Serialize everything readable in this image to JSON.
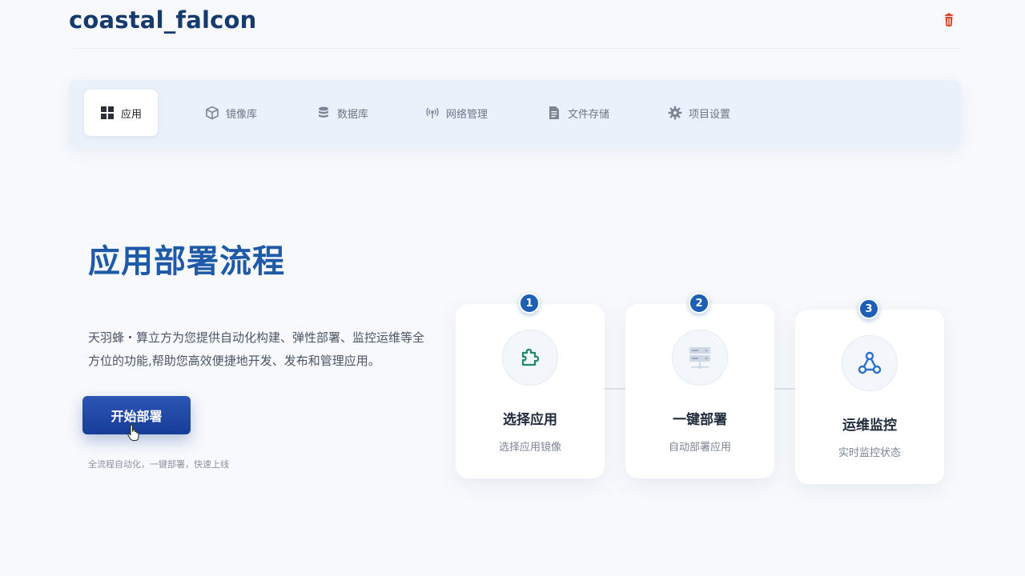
{
  "header": {
    "brand": "coastal_falcon",
    "delete_icon": "trash-icon"
  },
  "nav": {
    "tabs": [
      {
        "label": "应用",
        "icon": "grid-icon",
        "active": true
      },
      {
        "label": "镜像库",
        "icon": "cube-icon",
        "active": false
      },
      {
        "label": "数据库",
        "icon": "database-icon",
        "active": false
      },
      {
        "label": "网络管理",
        "icon": "broadcast-icon",
        "active": false
      },
      {
        "label": "文件存储",
        "icon": "file-icon",
        "active": false
      },
      {
        "label": "项目设置",
        "icon": "gear-icon",
        "active": false
      }
    ]
  },
  "hero": {
    "title": "应用部署流程",
    "description": "天羽蜂・算立方为您提供自动化构建、弹性部署、监控运维等全方位的功能,帮助您高效便捷地开发、发布和管理应用。",
    "cta_label": "开始部署",
    "note": "全流程自动化，一键部署，快速上线"
  },
  "steps": [
    {
      "number": "1",
      "title": "选择应用",
      "subtitle": "选择应用镜像",
      "icon": "puzzle-icon"
    },
    {
      "number": "2",
      "title": "一键部署",
      "subtitle": "自动部署应用",
      "icon": "server-icon"
    },
    {
      "number": "3",
      "title": "运维监控",
      "subtitle": "实时监控状态",
      "icon": "network-icon"
    }
  ],
  "colors": {
    "brand": "#173a6e",
    "accent": "#1f5aa8",
    "danger": "#d9462b",
    "step_badge": "#1c5fb5"
  }
}
